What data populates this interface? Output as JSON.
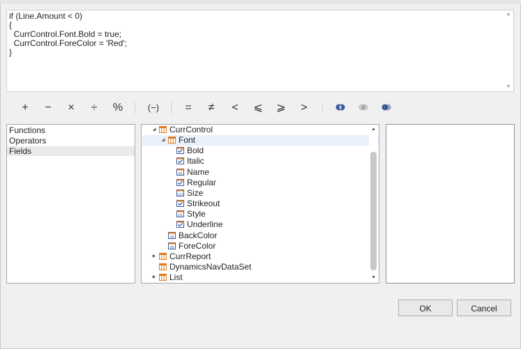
{
  "editor": {
    "expression": "if (Line.Amount < 0)\n{\n  CurrControl.Font.Bold = true;\n  CurrControl.ForeColor = 'Red';\n}"
  },
  "operators": {
    "plus": "+",
    "minus": "−",
    "multiply": "×",
    "divide": "÷",
    "modulo": "%",
    "negate": "(−)",
    "equal": "=",
    "not_equal": "≠",
    "less": "<",
    "less_equal": "⩽",
    "greater_equal": "⩾",
    "greater": ">"
  },
  "categories": [
    {
      "label": "Functions"
    },
    {
      "label": "Operators"
    },
    {
      "label": "Fields"
    }
  ],
  "tree": {
    "items": [
      {
        "label": "CurrControl"
      },
      {
        "label": "Font"
      },
      {
        "label": "Bold"
      },
      {
        "label": "Italic"
      },
      {
        "label": "Name"
      },
      {
        "label": "Regular"
      },
      {
        "label": "Size"
      },
      {
        "label": "Strikeout"
      },
      {
        "label": "Style"
      },
      {
        "label": "Underline"
      },
      {
        "label": "BackColor"
      },
      {
        "label": "ForeColor"
      },
      {
        "label": "CurrReport"
      },
      {
        "label": "DynamicsNavDataSet"
      },
      {
        "label": "List"
      }
    ]
  },
  "buttons": {
    "ok": "OK",
    "cancel": "Cancel"
  },
  "colors": {
    "accent_blue": "#3a5a9c",
    "selection": "#e8f0fb",
    "icon_orange": "#e07a1f"
  }
}
